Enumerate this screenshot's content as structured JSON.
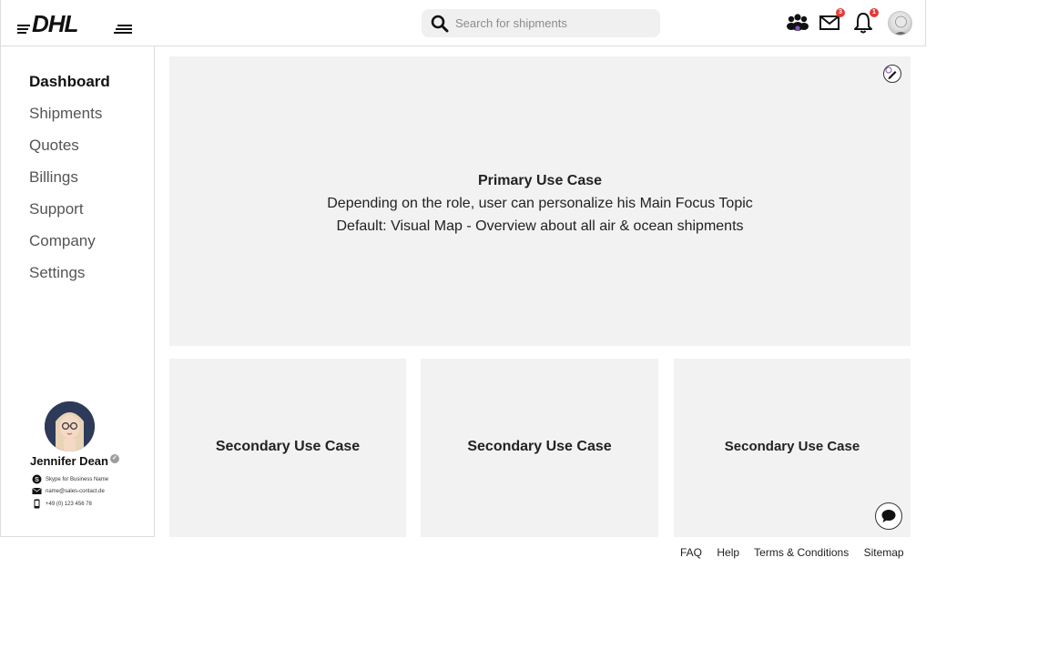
{
  "header": {
    "logo_text": "DHL",
    "search_placeholder": "Search for shipments",
    "messages_badge": "3",
    "notifications_badge": "1"
  },
  "sidebar": {
    "items": [
      {
        "label": "Dashboard",
        "active": true
      },
      {
        "label": "Shipments",
        "active": false
      },
      {
        "label": "Quotes",
        "active": false
      },
      {
        "label": "Billings",
        "active": false
      },
      {
        "label": "Support",
        "active": false
      },
      {
        "label": "Company",
        "active": false
      },
      {
        "label": "Settings",
        "active": false
      }
    ],
    "contact": {
      "name": "Jennifer Dean",
      "skype": "Skype for Business Name",
      "email": "name@sales-contact.de",
      "phone": "+49 (0) 123 456 78"
    }
  },
  "main": {
    "primary": {
      "title": "Primary Use Case",
      "line1": "Depending on the role, user can personalize his Main Focus Topic",
      "line2": "Default: Visual Map - Overview about all air & ocean shipments"
    },
    "secondary": [
      {
        "label": "Secondary Use Case"
      },
      {
        "label": "Secondary Use Case"
      },
      {
        "label": "Secondary Use Case"
      }
    ]
  },
  "footer": {
    "links": [
      "FAQ",
      "Help",
      "Terms & Conditions",
      "Sitemap"
    ]
  },
  "colors": {
    "panel_bg": "#f2f2f2",
    "badge": "#e53935",
    "brand_red": "#d40511"
  }
}
